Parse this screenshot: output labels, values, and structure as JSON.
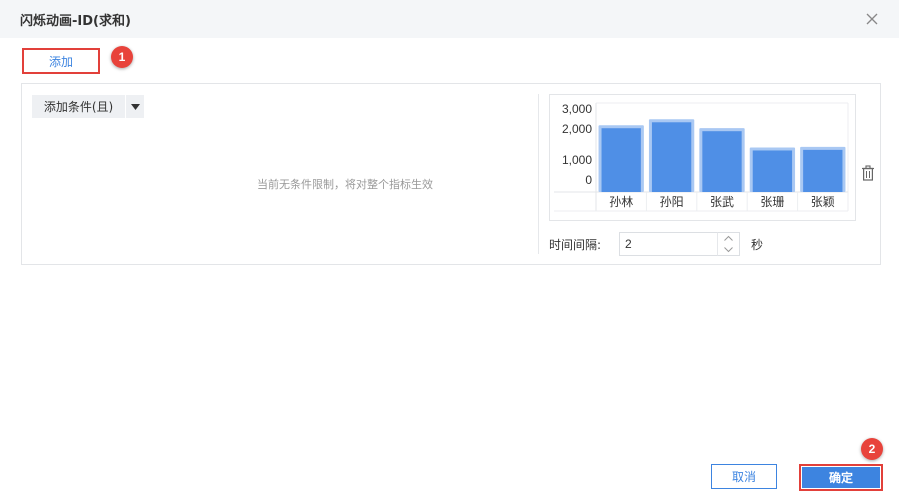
{
  "dialog": {
    "title": "闪烁动画-ID(求和)"
  },
  "toolbar": {
    "add_label": "添加"
  },
  "markers": {
    "first": "1",
    "second": "2"
  },
  "conditions": {
    "add_condition_label": "添加条件(且)",
    "empty_hint": "当前无条件限制，将对整个指标生效"
  },
  "chart_data": {
    "type": "bar",
    "categories": [
      "孙林",
      "孙阳",
      "张武",
      "张珊",
      "张颖"
    ],
    "values": [
      2150,
      2350,
      2050,
      1400,
      1420
    ],
    "y_ticks": [
      0,
      1000,
      2000,
      3000
    ],
    "y_tick_labels": [
      "0",
      "1,000",
      "2,000",
      "3,000"
    ],
    "ylim": [
      0,
      3000
    ],
    "grid": true,
    "bar_color": "#4f8fe6",
    "bar_highlight": "#a9c8f3"
  },
  "interval": {
    "label": "时间间隔:",
    "value": "2",
    "unit": "秒"
  },
  "footer": {
    "cancel_label": "取消",
    "ok_label": "确定"
  },
  "colors": {
    "accent": "#3d84e0",
    "highlight_border": "#e2403a",
    "marker": "#e8433b"
  }
}
